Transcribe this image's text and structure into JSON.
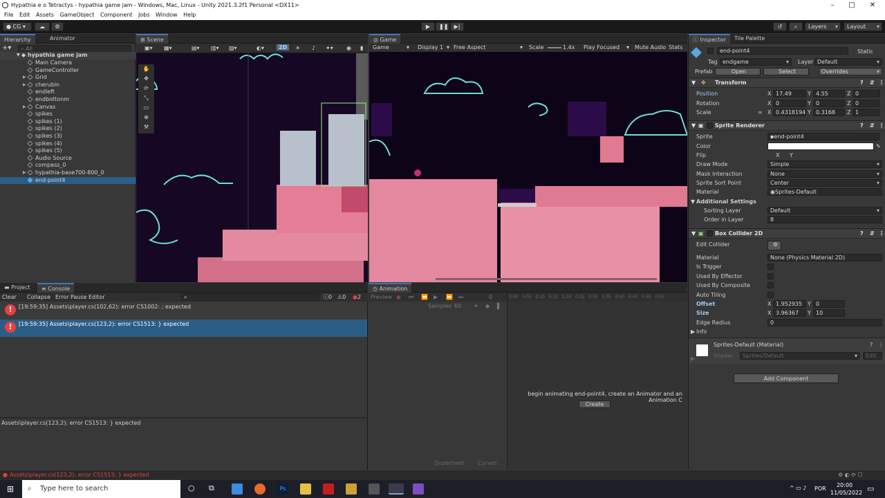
{
  "window": {
    "title": "Hypathia e o Tetractys - hypathia game jam - Windows, Mac, Linux - Unity 2021.3.2f1 Personal <DX11>"
  },
  "menu": [
    "File",
    "Edit",
    "Assets",
    "GameObject",
    "Component",
    "Jobs",
    "Window",
    "Help"
  ],
  "toolbar": {
    "account": "CG",
    "layers": "Layers",
    "layout": "Layout"
  },
  "hierarchy": {
    "tab": "Hierarchy",
    "tab2": "Animator",
    "search_placeholder": "All",
    "scene": "hypathia game jam",
    "items": [
      {
        "label": "Main Camera",
        "expand": false
      },
      {
        "label": "GameController",
        "expand": false
      },
      {
        "label": "Grid",
        "expand": true
      },
      {
        "label": "cherubin",
        "expand": true
      },
      {
        "label": "endleft",
        "expand": false
      },
      {
        "label": "endbottonm",
        "expand": false
      },
      {
        "label": "Canvas",
        "expand": true
      },
      {
        "label": "spikes",
        "expand": false
      },
      {
        "label": "spikes (1)",
        "expand": false
      },
      {
        "label": "spikes (2)",
        "expand": false
      },
      {
        "label": "spikes (3)",
        "expand": false
      },
      {
        "label": "spikes (4)",
        "expand": false
      },
      {
        "label": "spikes (5)",
        "expand": false
      },
      {
        "label": "Audio Source",
        "expand": false
      },
      {
        "label": "compass_0",
        "expand": false
      },
      {
        "label": "hypathia-base700-800_0",
        "expand": true
      },
      {
        "label": "end-point4",
        "expand": false,
        "selected": true
      }
    ]
  },
  "scene": {
    "tab": "Scene",
    "mode2d": "2D"
  },
  "game": {
    "tab": "Game",
    "display_mode": "Game",
    "display": "Display 1",
    "aspect": "Free Aspect",
    "scale_label": "Scale",
    "scale": "1.4x",
    "play_focused": "Play Focused",
    "mute": "Mute Audio",
    "stats": "Stats"
  },
  "console": {
    "tab_project": "Project",
    "tab": "Console",
    "clear": "Clear",
    "collapse": "Collapse",
    "error_pause": "Error Pause",
    "editor": "Editor",
    "count_log": "0",
    "count_warn": "0",
    "count_err": "2",
    "messages": [
      "[19:59:35] Assets\\player.cs(102,62): error CS1002: ; expected",
      "[19:59:35] Assets\\player.cs(123,2): error CS1513: } expected"
    ],
    "detail": "Assets\\player.cs(123,2): error CS1513: } expected"
  },
  "animation": {
    "tab": "Animation",
    "preview": "Preview",
    "samples_label": "Samples",
    "samples": "60",
    "frame": "0",
    "ticks": [
      "0:00",
      "0:05",
      "0:10",
      "0:15",
      "0:20",
      "0:25",
      "0:30",
      "0:35",
      "0:40",
      "0:45",
      "0:50",
      "0:55"
    ],
    "message": "begin animating end-point4, create an Animator and an Animation C",
    "create": "Create",
    "dopesheet": "Dopesheet",
    "curves": "Curves"
  },
  "inspector": {
    "tab": "Inspector",
    "tab2": "Tile Palette",
    "object_name": "end-point4",
    "static": "Static",
    "tag_label": "Tag",
    "tag": "endgame",
    "layer_label": "Layer",
    "layer": "Default",
    "prefab": "Prefab",
    "open": "Open",
    "select": "Select",
    "overrides": "Overrides",
    "transform": {
      "title": "Transform",
      "position": {
        "label": "Position",
        "x": "17.49",
        "y": "4.55",
        "z": "0"
      },
      "rotation": {
        "label": "Rotation",
        "x": "0",
        "y": "0",
        "z": "0"
      },
      "scale": {
        "label": "Scale",
        "x": "0.4318194",
        "y": "0.3168",
        "z": "1"
      }
    },
    "sprite_renderer": {
      "title": "Sprite Renderer",
      "sprite_label": "Sprite",
      "sprite": "end-point4",
      "color_label": "Color",
      "flip_label": "Flip",
      "flip_x": "X",
      "flip_y": "Y",
      "draw_mode_label": "Draw Mode",
      "draw_mode": "Simple",
      "mask_label": "Mask Interaction",
      "mask": "None",
      "sort_point_label": "Sprite Sort Point",
      "sort_point": "Center",
      "material_label": "Material",
      "material": "Sprites-Default",
      "additional": "Additional Settings",
      "sorting_layer_label": "Sorting Layer",
      "sorting_layer": "Default",
      "order_label": "Order in Layer",
      "order": "8"
    },
    "box_collider": {
      "title": "Box Collider 2D",
      "edit_label": "Edit Collider",
      "material_label": "Material",
      "material": "None (Physics Material 2D)",
      "trigger_label": "Is Trigger",
      "effector_label": "Used By Effector",
      "composite_label": "Used By Composite",
      "auto_tiling_label": "Auto Tiling",
      "offset_label": "Offset",
      "offset_x": "1.952935",
      "offset_y": "0",
      "size_label": "Size",
      "size_x": "3.96367",
      "size_y": "10",
      "edge_label": "Edge Radius",
      "edge": "0",
      "info": "Info"
    },
    "material_block": {
      "name": "Sprites-Default (Material)",
      "shader_label": "Shader",
      "shader": "Sprites/Default",
      "edit": "Edit..."
    },
    "add_component": "Add Component"
  },
  "statusbar": {
    "text": "Assets\\player.cs(123,2): error CS1513: } expected"
  },
  "taskbar": {
    "search": "Type here to search",
    "lang": "POR",
    "time": "20:00",
    "date": "11/05/2022"
  },
  "colors": {
    "accent": "#3a79bb",
    "error": "#e84040",
    "sky": "#160724",
    "pink": "#e0788e"
  }
}
